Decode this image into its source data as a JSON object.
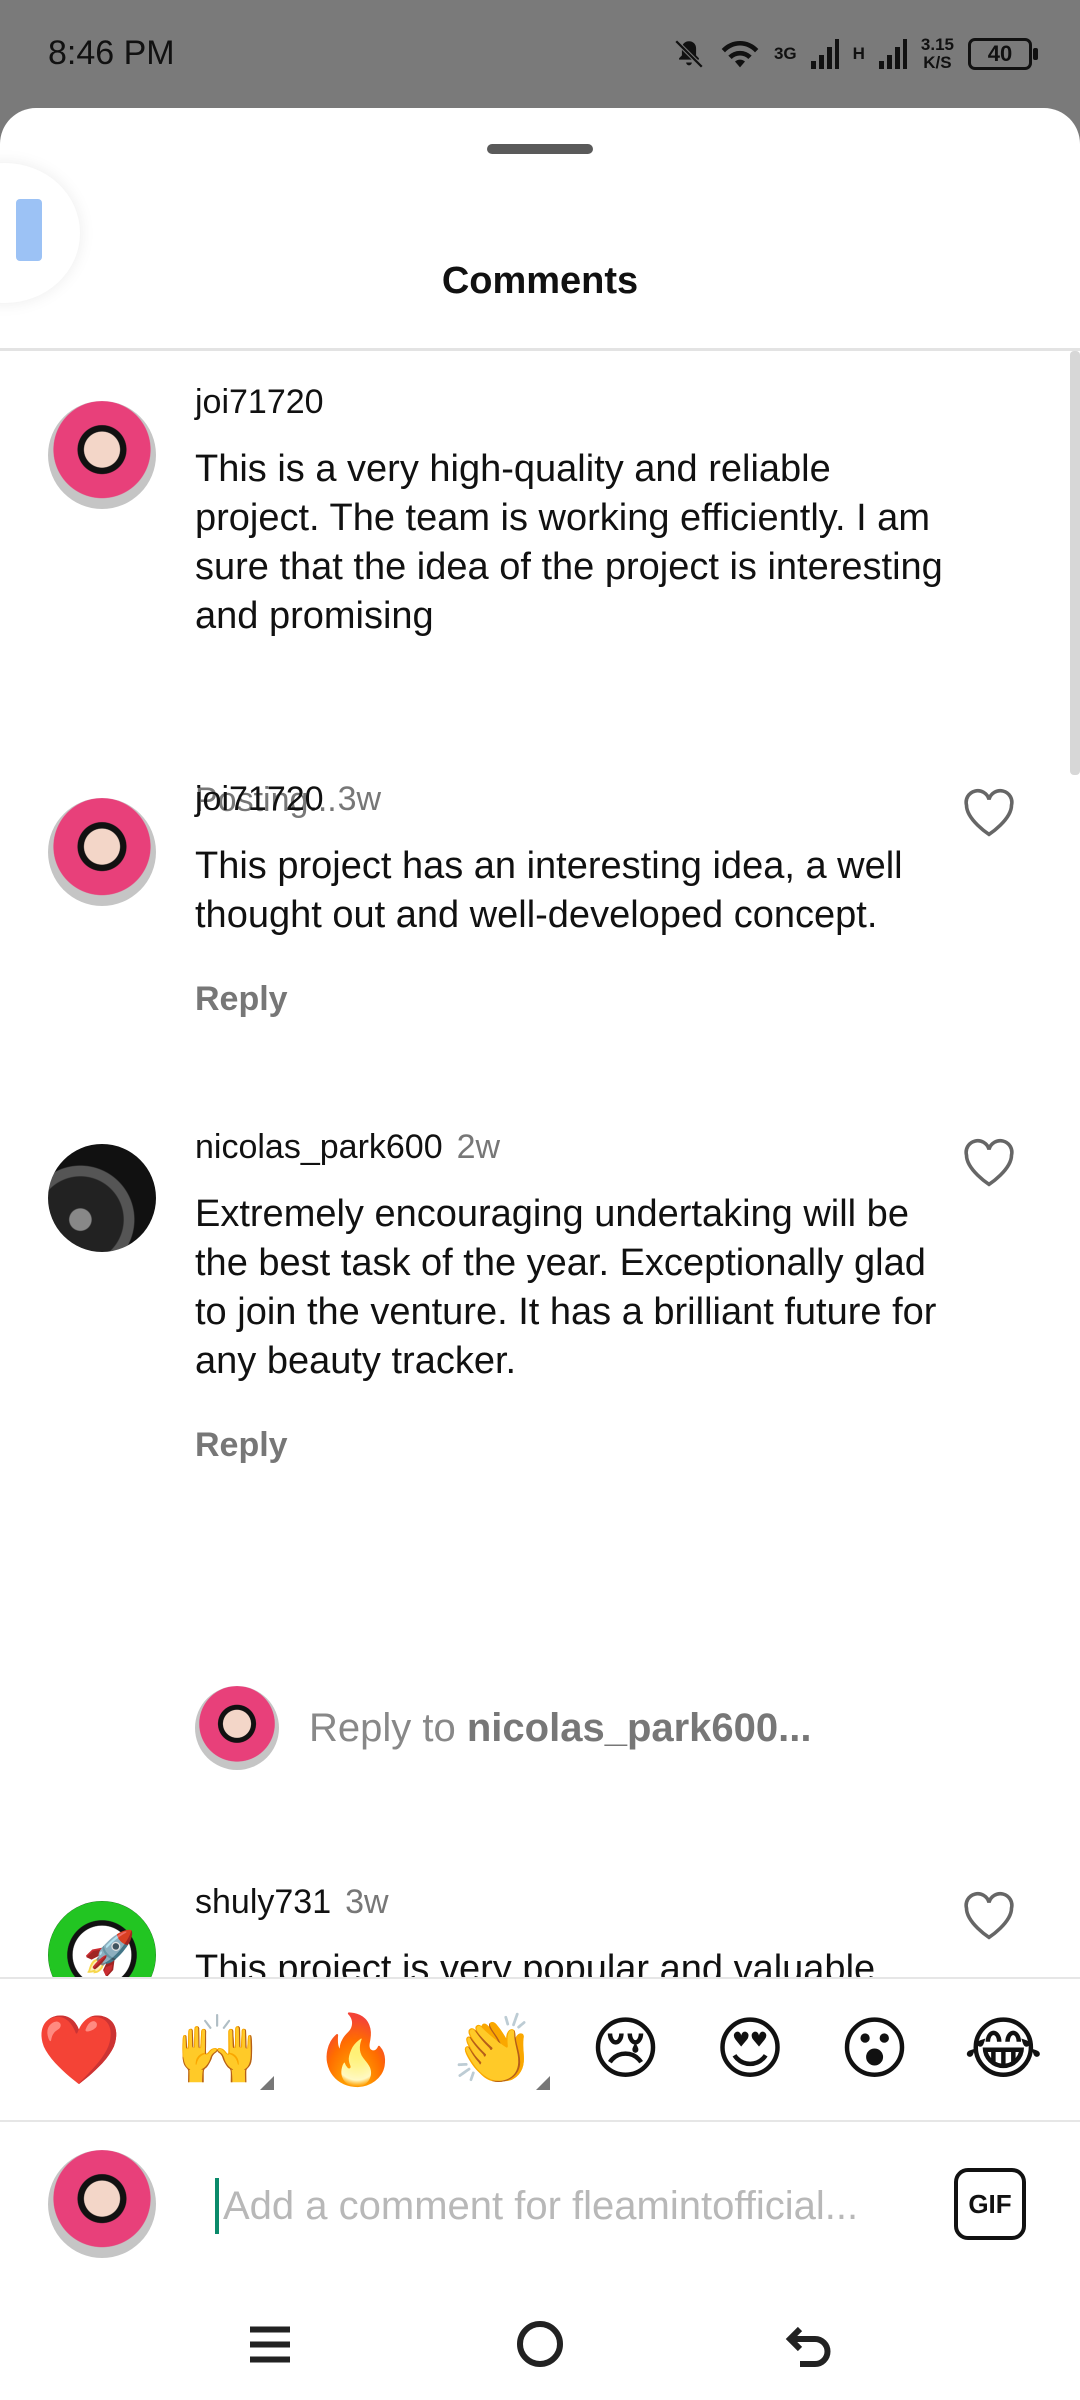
{
  "status_bar": {
    "time": "8:46 PM",
    "network_1": "3G",
    "network_2": "H",
    "speed_value": "3.15",
    "speed_unit": "K/S",
    "battery": "40"
  },
  "sheet": {
    "title": "Comments"
  },
  "comments": [
    {
      "username": "joi71720",
      "age": "",
      "text": "This is a very high-quality and reliable project. The team is working efficiently. I am sure that the idea of the project is interesting and promising",
      "meta": "Posting..."
    },
    {
      "username": "joi71720",
      "age": "3w",
      "text": "This project has an interesting idea, a well thought out and well-developed concept.",
      "meta": "Reply"
    },
    {
      "username": "nicolas_park600",
      "age": "2w",
      "text": "Extremely encouraging undertaking will be the best task of the year. Exceptionally glad to join the venture. It has a brilliant future for any beauty tracker.",
      "meta": "Reply"
    },
    {
      "username": "shuly731",
      "age": "3w",
      "text": "This project is very popular and valuable also in many unique features and creative ideas. A potential project for the good future.",
      "meta": ""
    }
  ],
  "reply_prompt": {
    "prefix": "Reply to ",
    "target": "nicolas_park600..."
  },
  "emoji_bar": [
    "❤️",
    "🙌",
    "🔥",
    "👏",
    "😢",
    "😍",
    "😮",
    "😂"
  ],
  "composer": {
    "placeholder": "Add a comment for fleamintofficial...",
    "gif_label": "GIF"
  },
  "icons": {
    "heart": "heart-outline-icon",
    "menu": "menu-icon",
    "home": "home-icon",
    "back": "back-icon"
  }
}
